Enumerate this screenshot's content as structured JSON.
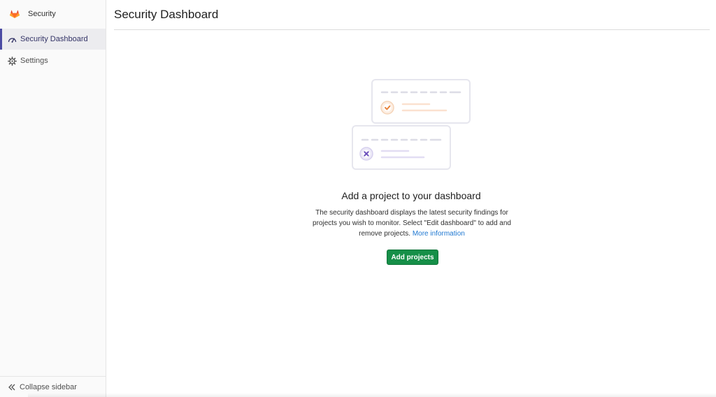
{
  "sidebar": {
    "title": "Security",
    "logo_icon": "gitlab-logo",
    "items": [
      {
        "label": "Security Dashboard",
        "icon": "dashboard-gauge-icon",
        "active": true
      },
      {
        "label": "Settings",
        "icon": "gear-icon",
        "active": false
      }
    ],
    "collapse_label": "Collapse sidebar"
  },
  "main": {
    "page_title": "Security Dashboard",
    "empty_state": {
      "title": "Add a project to your dashboard",
      "description": "The security dashboard displays the latest security findings for projects you wish to monitor. Select \"Edit dashboard\" to add and remove projects.",
      "link_label": "More information",
      "button_label": "Add projects"
    }
  },
  "colors": {
    "accent_active": "#4b4ba3",
    "button_green": "#168f48",
    "link_blue": "#1f78d1",
    "check_orange": "#e8833a",
    "cross_purple": "#6b4fbb"
  }
}
